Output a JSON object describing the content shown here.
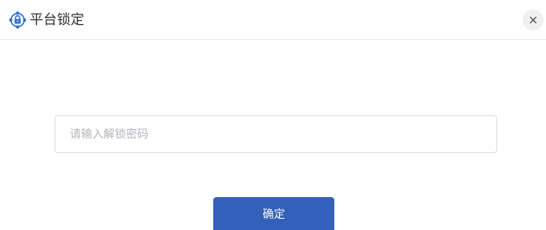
{
  "dialog": {
    "title": "平台锁定",
    "icon": "lock-network-icon",
    "close_icon": "close-icon"
  },
  "form": {
    "password_placeholder": "请输入解锁密码",
    "password_value": ""
  },
  "actions": {
    "confirm_label": "确定"
  },
  "colors": {
    "primary": "#3360b8",
    "icon_blue": "#2b6fd6",
    "title_text": "#303133",
    "placeholder": "#b4b6bb",
    "border": "#dcdfe6"
  }
}
